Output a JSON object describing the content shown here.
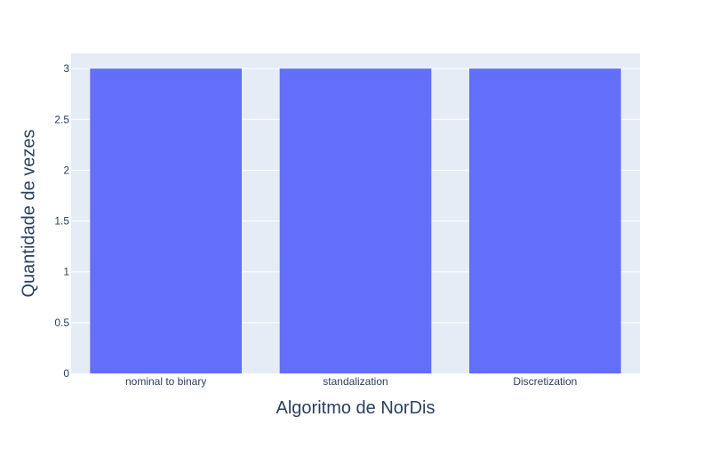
{
  "chart_data": {
    "type": "bar",
    "categories": [
      "nominal to binary",
      "standalization",
      "Discretization"
    ],
    "values": [
      3,
      3,
      3
    ],
    "title": "",
    "xlabel": "Algoritmo de NorDis",
    "ylabel": "Quantidade de vezes",
    "ylim": [
      0,
      3.15
    ],
    "yticks": [
      0,
      0.5,
      1,
      1.5,
      2,
      2.5,
      3
    ],
    "ytick_labels": [
      "0",
      "0.5",
      "1",
      "1.5",
      "2",
      "2.5",
      "3"
    ],
    "grid": true,
    "legend": "none",
    "colors": {
      "bar": "#636efa",
      "plot_background": "#e5ecf6",
      "grid": "#ffffff",
      "text": "#2a3f5f"
    }
  }
}
